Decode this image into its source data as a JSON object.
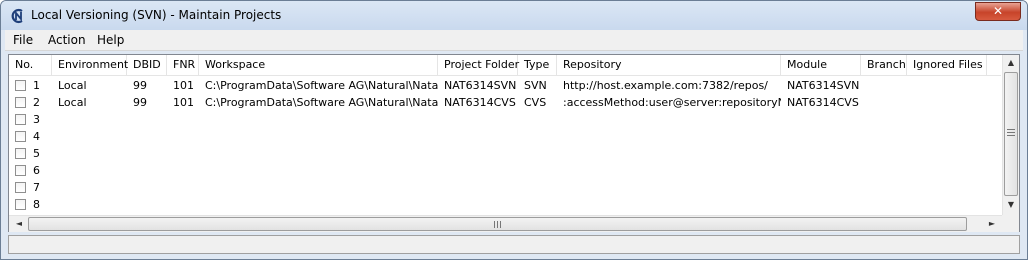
{
  "window": {
    "title": "Local Versioning (SVN) - Maintain Projects",
    "close_label": "✕"
  },
  "menu": {
    "items": [
      {
        "label": "File"
      },
      {
        "label": "Action"
      },
      {
        "label": "Help"
      }
    ]
  },
  "table": {
    "columns": [
      "No.",
      "Environment",
      "DBID",
      "FNR",
      "Workspace",
      "Project Folder",
      "Type",
      "Repository",
      "Module",
      "Branch",
      "Ignored Files"
    ],
    "rows": [
      {
        "no": "1",
        "environment": "Local",
        "dbid": "99",
        "fnr": "101",
        "workspace": "C:\\ProgramData\\Software AG\\Natural\\Natapps",
        "project_folder": "NAT6314SVN",
        "type": "SVN",
        "repository": "http://host.example.com:7382/repos/",
        "module": "NAT6314SVN",
        "branch": "",
        "ignored_files": ""
      },
      {
        "no": "2",
        "environment": "Local",
        "dbid": "99",
        "fnr": "101",
        "workspace": "C:\\ProgramData\\Software AG\\Natural\\Natapps",
        "project_folder": "NAT6314CVS",
        "type": "CVS",
        "repository": ":accessMethod:user@server:repositoryName",
        "module": "NAT6314CVS",
        "branch": "",
        "ignored_files": ""
      },
      {
        "no": "3"
      },
      {
        "no": "4"
      },
      {
        "no": "5"
      },
      {
        "no": "6"
      },
      {
        "no": "7"
      },
      {
        "no": "8"
      }
    ]
  },
  "scrollbars": {
    "up_icon": "▲",
    "down_icon": "▼",
    "left_icon": "◄",
    "right_icon": "►"
  },
  "status": {
    "text": ""
  }
}
